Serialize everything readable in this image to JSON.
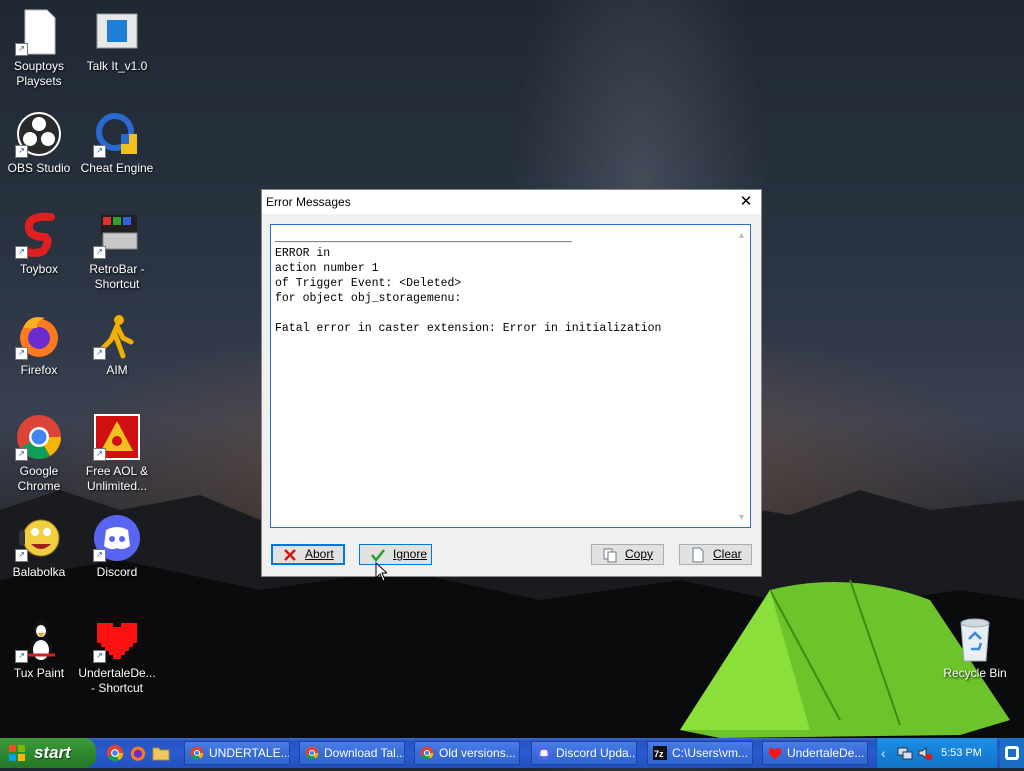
{
  "desktop": {
    "icons": [
      {
        "label": "Souptoys Playsets",
        "icon": "document-icon"
      },
      {
        "label": "Talk It_v1.0",
        "icon": "app-window-icon"
      },
      {
        "label": "OBS Studio",
        "icon": "obs-icon"
      },
      {
        "label": "Cheat Engine",
        "icon": "cheat-engine-icon"
      },
      {
        "label": "Toybox",
        "icon": "toybox-icon"
      },
      {
        "label": "RetroBar - Shortcut",
        "icon": "retrobar-icon"
      },
      {
        "label": "Firefox",
        "icon": "firefox-icon"
      },
      {
        "label": "AIM",
        "icon": "aim-icon"
      },
      {
        "label": "Google Chrome",
        "icon": "chrome-icon"
      },
      {
        "label": "Free AOL & Unlimited...",
        "icon": "aol-icon"
      },
      {
        "label": "Balabolka",
        "icon": "balabolka-icon"
      },
      {
        "label": "Discord",
        "icon": "discord-icon"
      },
      {
        "label": "Tux Paint",
        "icon": "tux-icon"
      },
      {
        "label": "UndertaleDe... - Shortcut",
        "icon": "heart-icon"
      },
      {
        "label": "Recycle Bin",
        "icon": "recycle-bin-icon"
      }
    ]
  },
  "dialog": {
    "title": "Error Messages",
    "close_glyph": "✕",
    "message_lines": [
      "___________________________________________",
      "ERROR in",
      "action number 1",
      "of Trigger Event: <Deleted>",
      "for object obj_storagemenu:",
      "",
      "Fatal error in caster extension: Error in initialization"
    ],
    "buttons": {
      "abort": "Abort",
      "ignore": "Ignore",
      "copy": "Copy",
      "clear": "Clear"
    }
  },
  "taskbar": {
    "start_label": "start",
    "tasks": [
      {
        "label": "UNDERTALE...",
        "icon": "chrome-icon"
      },
      {
        "label": "Download Tal...",
        "icon": "chrome-icon"
      },
      {
        "label": "Old versions...",
        "icon": "chrome-icon"
      },
      {
        "label": "Discord Upda...",
        "icon": "discord-icon"
      },
      {
        "label": "C:\\Users\\vm...",
        "icon": "7zip-icon"
      },
      {
        "label": "UndertaleDe...",
        "icon": "heart-icon"
      }
    ],
    "clock": "5:53 PM"
  },
  "colors": {
    "taskbar_blue": "#2454c2",
    "start_green": "#2f8a2f",
    "dialog_focus": "#0078d7",
    "tray_blue": "#1581d8"
  }
}
